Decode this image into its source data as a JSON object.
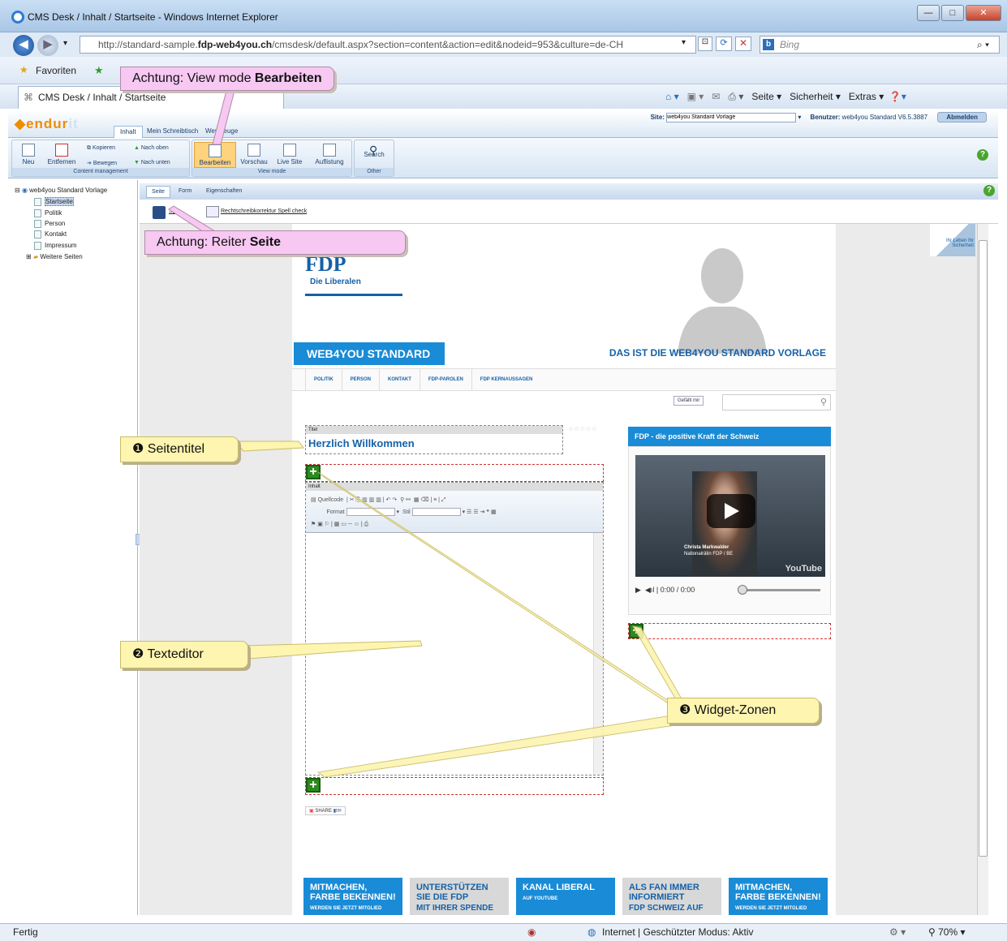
{
  "window": {
    "title": "CMS Desk / Inhalt / Startseite - Windows Internet Explorer",
    "min": "—",
    "max": "□",
    "close": "✕"
  },
  "address": {
    "url_prefix": "http://standard-sample.",
    "url_bold": "fdp-web4you.ch",
    "url_suffix": "/cmsdesk/default.aspx?section=content&action=edit&nodeid=953&culture=de-CH",
    "search_placeholder": "Bing"
  },
  "favorites": {
    "label": "Favoriten"
  },
  "tab": {
    "label": "CMS Desk / Inhalt / Startseite"
  },
  "commandbar": {
    "seite": "Seite ▾",
    "sicherheit": "Sicherheit ▾",
    "extras": "Extras ▾"
  },
  "cms": {
    "logo_a": "endur",
    "logo_b": "it",
    "tabs": [
      "Inhalt",
      "Mein Schreibtisch",
      "Werkzeuge"
    ],
    "site_label": "Site:",
    "site_value": "web4you Standard Vorlage",
    "user_label": "Benutzer:",
    "user_value": "web4you Standard  V6.5.3887",
    "logout": "Abmelden"
  },
  "ribbon": {
    "neu": "Neu",
    "entfernen": "Entfernen",
    "kopieren": "Kopieren",
    "bewegen": "Bewegen",
    "nach_oben": "Nach oben",
    "nach_unten": "Nach unten",
    "group1": "Content management",
    "bearbeiten": "Bearbeiten",
    "vorschau": "Vorschau",
    "live_site": "Live Site",
    "auflistung": "Auflistung",
    "group2": "View mode",
    "search": "Search",
    "group3": "Other"
  },
  "tree": {
    "root": "web4you Standard Vorlage",
    "items": [
      "Startseite",
      "Politik",
      "Person",
      "Kontakt",
      "Impressum"
    ],
    "more": "Weitere Seiten"
  },
  "pagetabs": [
    "Seite",
    "Form",
    "Eigenschaften"
  ],
  "savebar": {
    "save": "Spe",
    "spell": "Rechtschreibkorrektur Spell check"
  },
  "site": {
    "logo": "FDP",
    "logo_sub": "Die Liberalen",
    "banner": "WEB4YOU STANDARD",
    "slogan": "DAS IST DIE WEB4YOU STANDARD VORLAGE",
    "nav": [
      "POLITIK",
      "PERSON",
      "KONTAKT",
      "FDP-PAROLEN",
      "FDP KERNAUSSAGEN"
    ],
    "like": "Gefällt mir",
    "titel_label": "Titel",
    "titel_value": "Herzlich Willkommen",
    "inhalt_label": "Inhalt",
    "toolbar_line1": "Quellcode",
    "toolbar_format": "Format",
    "toolbar_stil": "Stil",
    "share": "SHARE",
    "sidebar_title": "FDP - die positive Kraft der Schweiz",
    "video_caption_name": "Christa Markwalder",
    "video_caption_role": "Nationalrätin FDP / BE",
    "video_brand": "YouTube",
    "video_time": "0:00 / 0:00",
    "corner": "Ihr Leben Ihr Sicherheit"
  },
  "promos": [
    {
      "title": "MITMACHEN, FARBE BEKENNEN!",
      "sub": "WERDEN SIE JETZT MITGLIED",
      "color": "#1a8bd6"
    },
    {
      "title": "UNTERSTÜTZEN SIE DIE FDP",
      "sub": "MIT IHRER SPENDE",
      "color": "#d8d8d8"
    },
    {
      "title": "KANAL LIBERAL",
      "sub": "AUF YOUTUBE",
      "color": "#1a8bd6"
    },
    {
      "title": "ALS FAN IMMER INFORMIERT",
      "sub": "FDP SCHWEIZ AUF",
      "color": "#d8d8d8"
    },
    {
      "title": "MITMACHEN, FARBE BEKENNEN!",
      "sub": "WERDEN SIE JETZT MITGLIED",
      "color": "#1a8bd6"
    }
  ],
  "status": {
    "left": "Fertig",
    "zone": "Internet | Geschützter Modus: Aktiv",
    "zoom": "70%"
  },
  "annotations": {
    "view_mode_prefix": "Achtung: View mode ",
    "view_mode_bold": "Bearbeiten",
    "reiter_prefix": "Achtung: Reiter ",
    "reiter_bold": "Seite",
    "seitentitel": "❶ Seitentitel",
    "texteditor": "❷ Texteditor",
    "widget": "❸ Widget-Zonen"
  }
}
